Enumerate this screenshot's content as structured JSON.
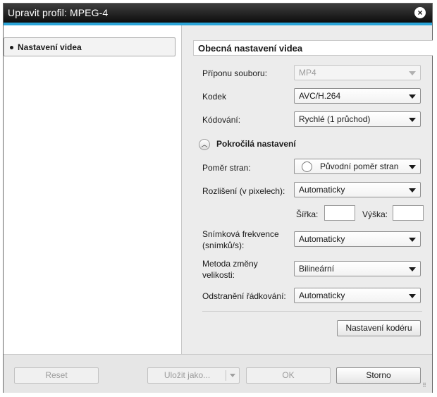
{
  "window": {
    "title": "Upravit profil: MPEG-4",
    "close_glyph": "⨂"
  },
  "sidebar": {
    "items": [
      {
        "label": "Nastavení videa",
        "selected": true
      }
    ]
  },
  "main": {
    "section_title": "Obecná nastavení videa",
    "fields": {
      "extension": {
        "label": "Příponu souboru:",
        "value": "MP4",
        "enabled": false
      },
      "codec": {
        "label": "Kodek",
        "value": "AVC/H.264"
      },
      "encoding": {
        "label": "Kódování:",
        "value": "Rychlé (1 průchod)"
      }
    },
    "advanced": {
      "label": "Pokročilá nastavení",
      "expanded": true,
      "aspect_ratio": {
        "label": "Poměr stran:",
        "value": "Původní poměr stran"
      },
      "resolution": {
        "label": "Rozlišení (v pixelech):",
        "value": "Automaticky"
      },
      "width": {
        "label": "Šířka:",
        "value": ""
      },
      "height": {
        "label": "Výška:",
        "value": ""
      },
      "frame_rate": {
        "label_line1": "Snímková frekvence",
        "label_line2": "(snímků/s):",
        "value": "Automaticky"
      },
      "resize_method": {
        "label_line1": "Metoda změny",
        "label_line2": "velikosti:",
        "value": "Bilineární"
      },
      "deinterlace": {
        "label": "Odstranění řádkování:",
        "value": "Automaticky"
      }
    },
    "encoder_settings_button": "Nastavení kodéru"
  },
  "footer": {
    "reset": "Reset",
    "save_as": "Uložit jako...",
    "ok": "OK",
    "cancel": "Storno"
  },
  "colors": {
    "accent": "#2aa4d8",
    "titlebar": "#1a1a1a"
  }
}
